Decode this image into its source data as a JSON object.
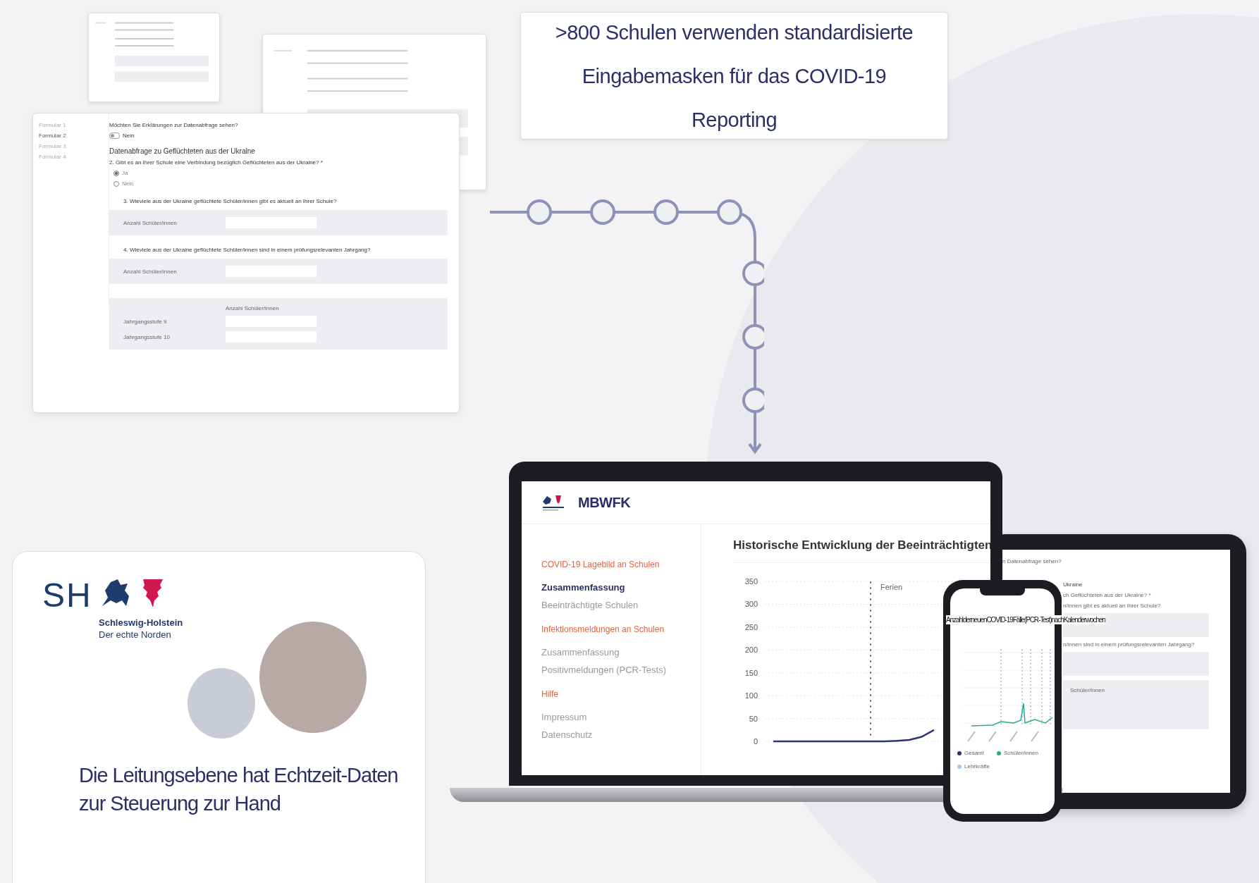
{
  "form": {
    "sidebar": [
      {
        "label": "Formular 1",
        "selected": false
      },
      {
        "label": "Formular 2",
        "selected": true
      },
      {
        "label": "Formular 3",
        "selected": false
      },
      {
        "label": "Formular 4",
        "selected": false
      }
    ],
    "toggle_question": "Möchten Sie Erklärungen zur Datenabfrage sehen?",
    "toggle": {
      "label": "Nein",
      "on": false
    },
    "heading": "Datenabfrage zu Geflüchteten aus der Ukraine",
    "radio_question": "2. Gibt es an Ihrer Schule eine Verbindung bezüglich Geflüchteten aus der Ukraine? *",
    "options": [
      {
        "label": "Ja",
        "selected": true
      },
      {
        "label": "Nein",
        "selected": false
      }
    ],
    "blocks": [
      {
        "kind": "single",
        "question": "3. Wieviele aus der Ukraine geflüchtete Schüler/innen gibt es aktuell an Ihrer Schule?",
        "fields": [
          {
            "label": "Anzahl Schüler/innen"
          }
        ]
      },
      {
        "kind": "single",
        "question": "4. Wieviele aus der Ukraine geflüchtete Schüler/innen sind  in einem prüfungsrelevanten Jahrgang?",
        "fields": [
          {
            "label": "Anzahl Schüler/innen"
          }
        ]
      },
      {
        "kind": "table",
        "column": "Anzahl Schüler/innen",
        "fields": [
          {
            "label": "Jahrgangsstufe 9"
          },
          {
            "label": "Jahrgangsstufe 10"
          }
        ]
      }
    ]
  },
  "callout": {
    "text": ">800 Schulen verwenden standardisierte Eingabemasken für das COVID-19 Reporting"
  },
  "dashboard": {
    "logo": "MBWFK",
    "nav": [
      {
        "title": "COVID-19 Lagebild an Schulen",
        "items": [
          {
            "label": "Zusammenfassung",
            "selected": true
          },
          {
            "label": "Beeinträchtigte Schulen",
            "selected": false
          }
        ]
      },
      {
        "title": "Infektionsmeldungen an Schulen",
        "items": [
          {
            "label": "Zusammenfassung",
            "selected": false
          },
          {
            "label": "Positivmeldungen (PCR-Tests)",
            "selected": false
          }
        ]
      },
      {
        "title": "Hilfe",
        "items": [
          {
            "label": "Impressum",
            "selected": false
          },
          {
            "label": "Datenschutz",
            "selected": false
          }
        ]
      }
    ],
    "chart_title": "Historische Entwicklung der Beeinträchtigten",
    "chart_data": {
      "type": "line",
      "grid": true,
      "yticks": [
        0,
        50,
        100,
        150,
        200,
        250,
        300,
        350
      ],
      "ylim": [
        0,
        350
      ],
      "series": [
        {
          "color": "#2e3470",
          "values": [
            0,
            0,
            0,
            0,
            0,
            0,
            0,
            0,
            0,
            0,
            1,
            3,
            10,
            25
          ]
        }
      ],
      "annotations": [
        {
          "text": "Ferien"
        }
      ]
    }
  },
  "phone": {
    "chart_title": "AnzahlderneuenCOVID-19Fälle(PCR-Test)nachKalenderwochen",
    "legend": [
      {
        "label": "Gesamt",
        "color": "#2e3470"
      },
      {
        "label": "Schüler/innen",
        "color": "#2aa890"
      },
      {
        "label": "Lehrkräfte",
        "color": "#9fcbea"
      }
    ]
  },
  "tablet": {
    "lines": [
      {
        "kind": "text",
        "text": "n Datenabfrage sehen?"
      },
      {
        "kind": "heading",
        "text": "Ukraine"
      },
      {
        "kind": "text",
        "text": "ch Geflüchteten aus der Ukraine? *"
      },
      {
        "kind": "text",
        "text": "n/innen gibt es aktuell an Ihrer Schule?"
      },
      {
        "kind": "band"
      },
      {
        "kind": "text",
        "text": "n/innen sind  in einem prüfungsrelevanten Jahrgang?"
      },
      {
        "kind": "band"
      },
      {
        "kind": "label",
        "text": "Schüler/innen"
      }
    ]
  },
  "card": {
    "logo_letters": "SH",
    "logo_name": "Schleswig-Holstein",
    "logo_tagline": "Der echte Norden",
    "headline": "Die Leitungsebene hat Echtzeit-Daten zur Steuerung zur Hand"
  }
}
